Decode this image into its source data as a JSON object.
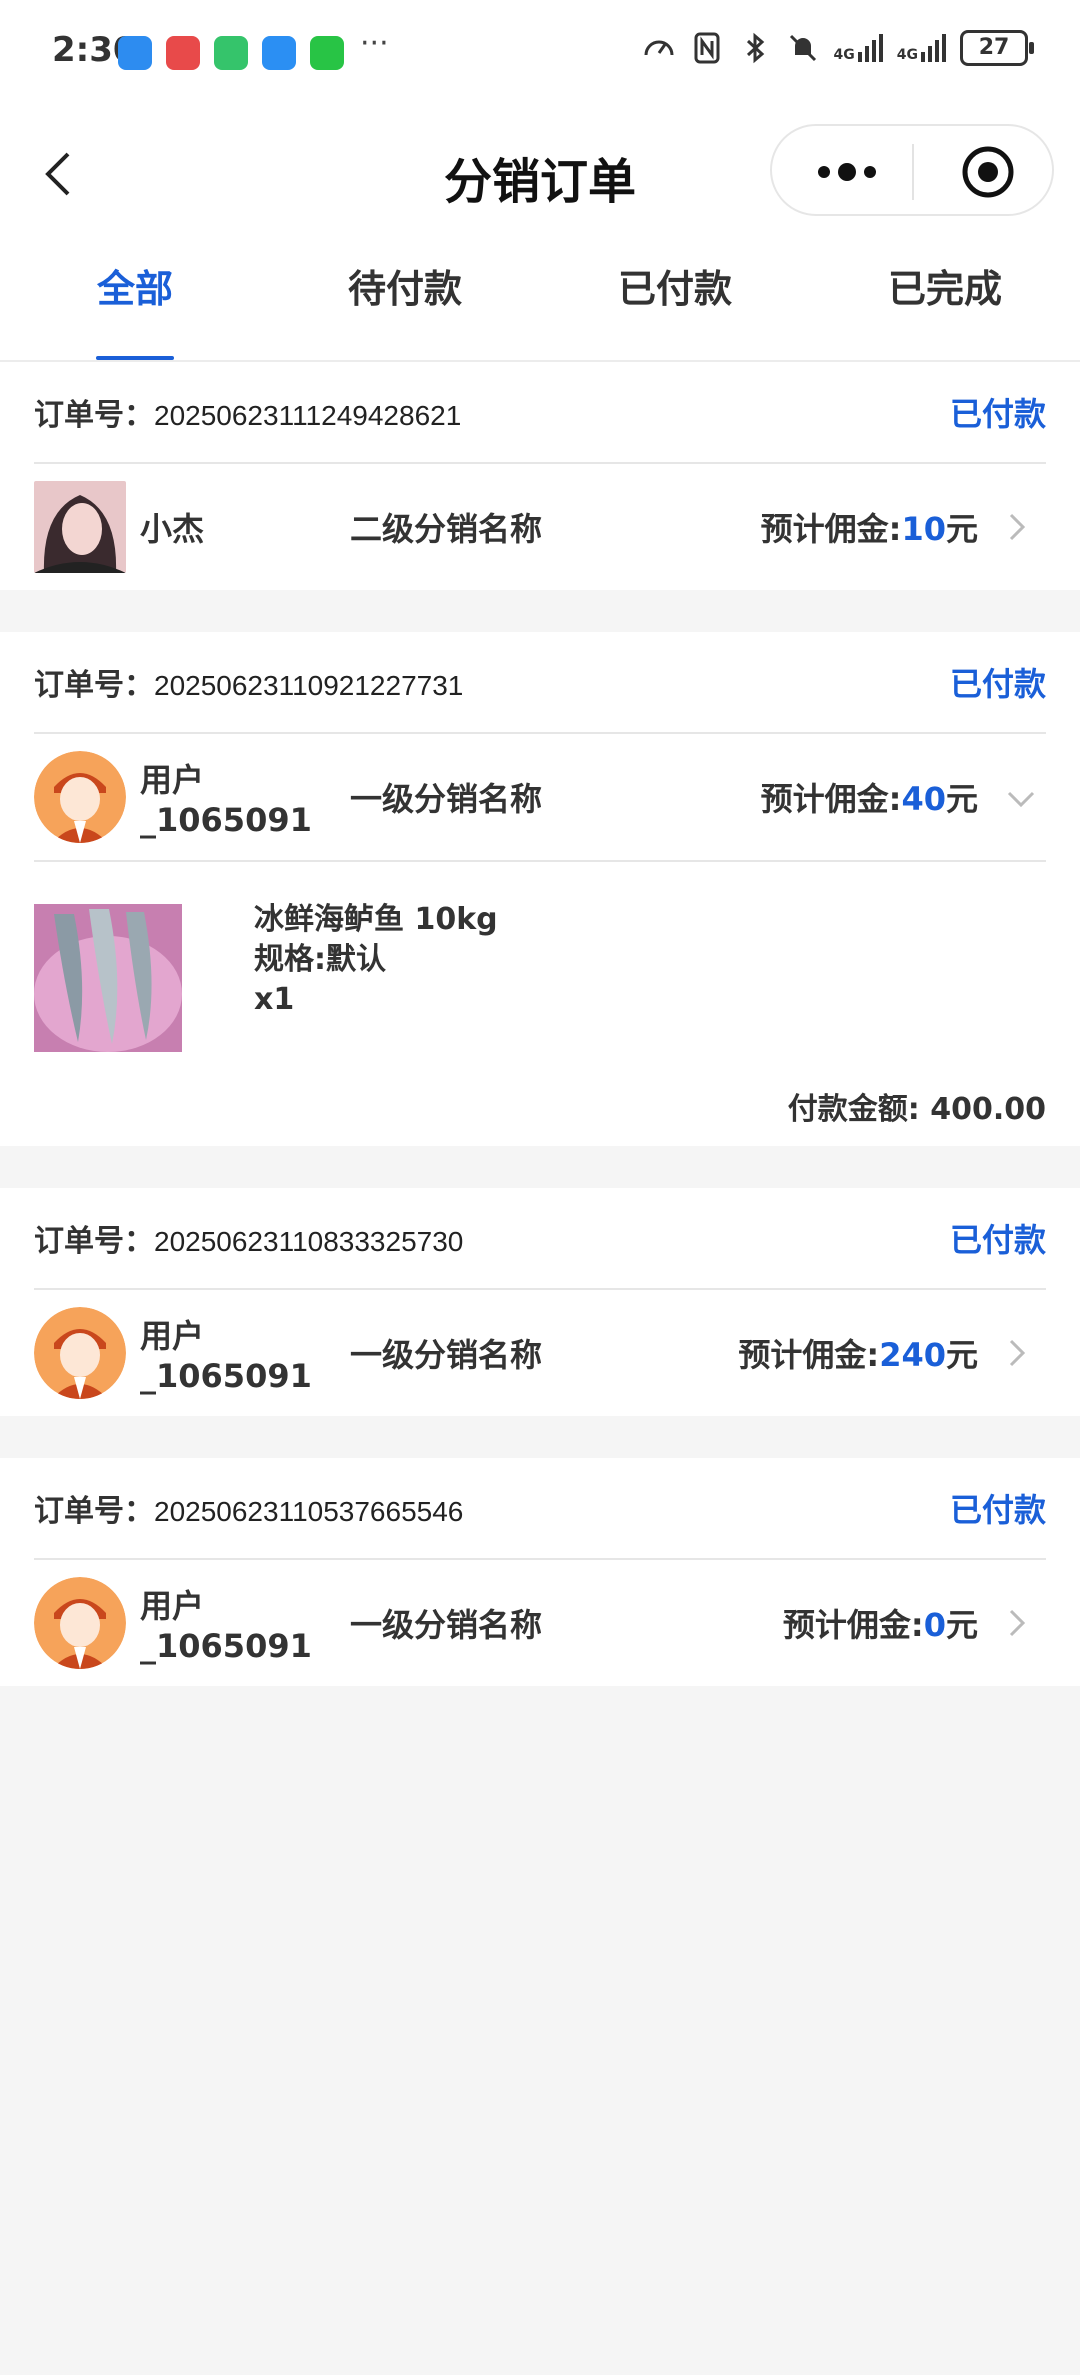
{
  "statusbar": {
    "time": "2:30",
    "net1": "4G",
    "net2": "4G",
    "battery": "27",
    "colors": {
      "app1": "#2d8cf0",
      "app2": "#e84a4a",
      "app3": "#35c46b",
      "app4": "#2b8ff3",
      "app5": "#28c445"
    }
  },
  "nav": {
    "title": "分销订单"
  },
  "tabs": [
    {
      "label": "全部",
      "active": true
    },
    {
      "label": "待付款",
      "active": false
    },
    {
      "label": "已付款",
      "active": false
    },
    {
      "label": "已完成",
      "active": false
    }
  ],
  "orders": [
    {
      "order_label": "订单号：",
      "order_no": "20250623111249428621",
      "status": "已付款",
      "user": "小杰",
      "level": "二级分销名称",
      "commission_label": "预计佣金:",
      "commission": "10",
      "unit": "元",
      "avatar": "photo"
    },
    {
      "order_label": "订单号：",
      "order_no": "20250623110921227731",
      "status": "已付款",
      "user": "用户_1065091",
      "level": "一级分销名称",
      "commission_label": "预计佣金:",
      "commission": "40",
      "unit": "元",
      "avatar": "cartoon",
      "expanded": true,
      "product": {
        "name": "冰鲜海鲈鱼 10kg",
        "spec": "规格:默认",
        "qty": "x1",
        "total": "付款金额: 400.00"
      }
    },
    {
      "order_label": "订单号：",
      "order_no": "20250623110833325730",
      "status": "已付款",
      "user": "用户_1065091",
      "level": "一级分销名称",
      "commission_label": "预计佣金:",
      "commission": "240",
      "unit": "元",
      "avatar": "cartoon"
    },
    {
      "order_label": "订单号：",
      "order_no": "20250623110537665546",
      "status": "已付款",
      "user": "用户_1065091",
      "level": "一级分销名称",
      "commission_label": "预计佣金:",
      "commission": "0",
      "unit": "元",
      "avatar": "cartoon"
    }
  ],
  "theme": {
    "accent": "#1a5fd8",
    "background": "#f5f5f5"
  }
}
